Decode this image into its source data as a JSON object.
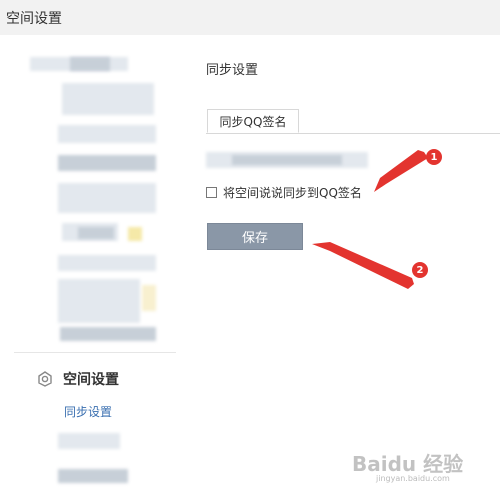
{
  "header": {
    "title": "空间设置"
  },
  "sidebar": {
    "section_label": "空间设置",
    "sub_item": "同步设置"
  },
  "main": {
    "title": "同步设置",
    "tab_label": "同步QQ签名",
    "checkbox_label": "将空间说说同步到QQ签名",
    "checkbox_checked": false,
    "save_label": "保存"
  },
  "annotations": {
    "marker_1": "1",
    "marker_2": "2"
  },
  "watermark": {
    "text": "Baidu 经验",
    "sub": "jingyan.baidu.com"
  },
  "colors": {
    "arrow": "#e3342f",
    "button": "#8a97a7",
    "link": "#3a6fb0"
  }
}
